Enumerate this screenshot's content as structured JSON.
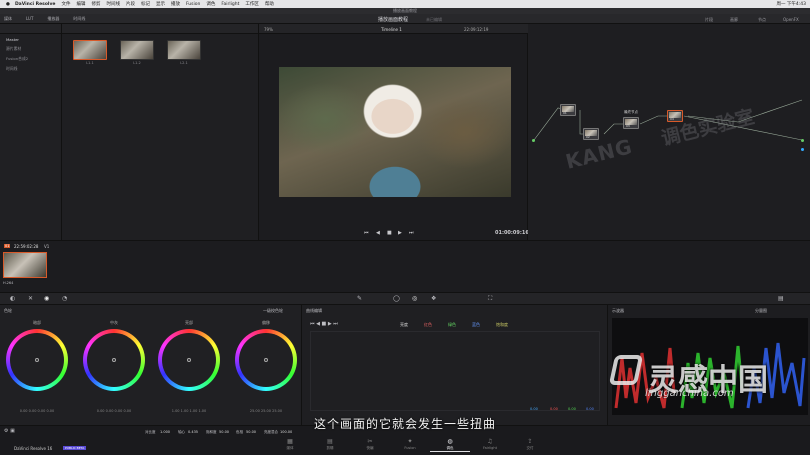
{
  "menubar": {
    "app": "DaVinci Resolve",
    "items": [
      "文件",
      "编辑",
      "修剪",
      "时间线",
      "片段",
      "标记",
      "显示",
      "播放",
      "Fusion",
      "调色",
      "Fairlight",
      "工作区",
      "帮助"
    ],
    "clock": "周一 下午4:43"
  },
  "window_title": "播放画面教程",
  "toolbar": {
    "items": [
      "媒体",
      "LUT",
      "播放器",
      "时间线"
    ],
    "project": "播放画面教程",
    "edited": "未已编辑",
    "right": [
      "片段",
      "画廊",
      "节点",
      "OpenFX"
    ]
  },
  "sidebar": {
    "items": [
      "Master",
      "源片素材",
      "Fusion合成2",
      "时间线"
    ]
  },
  "media": {
    "thumbs": [
      "L1.1",
      "L1.2",
      "L2.1"
    ]
  },
  "viewer": {
    "zoom": "79%",
    "timeline": "Timeline 1",
    "timecode": "22:09:12:19",
    "duration": "01:00:09:16"
  },
  "node_label": "最终节点",
  "clip": {
    "timecode": "22:59:02:28",
    "track": "V1",
    "codec": "H.264"
  },
  "wheels": {
    "title": "色轮",
    "mode": "一级校色轮",
    "labels": [
      "暗部",
      "中灰",
      "亮部",
      "偏移"
    ],
    "values": [
      "0.00  0.00  0.00  0.00",
      "0.00  0.00  0.00  0.00",
      "1.00  1.00  1.00  1.00",
      "25.00  25.00  25.00"
    ]
  },
  "bottom_params": {
    "contrast_label": "对比度",
    "contrast_value": "1.000",
    "pivot_label": "轴心",
    "pivot_value": "0.435",
    "sat_label": "饱和度",
    "sat_value": "50.00",
    "hue_label": "色相",
    "hue_value": "50.00",
    "lum_label": "亮度混合",
    "lum_value": "100.00"
  },
  "curves": {
    "title": "曲线编辑",
    "channels": [
      "亮度",
      "红色",
      "绿色",
      "蓝色",
      "饱和度"
    ],
    "values": [
      "0.00",
      "0.00",
      "0.00",
      "0.00"
    ]
  },
  "scope": {
    "title": "示波器",
    "mode": "分量图"
  },
  "bottom": {
    "app": "DaVinci Resolve 16",
    "badge": "PUBLIC BETA",
    "pages": [
      "媒体",
      "剪辑",
      "快编",
      "Fusion",
      "调色",
      "Fairlight",
      "交付"
    ],
    "active": "调色"
  },
  "subtitle": "这个画面的它就会发生一些扭曲",
  "watermark_kang": "KANG",
  "watermark_lab": "调色实验室",
  "watermark_logo": "灵感中国",
  "watermark_url": "lingganchina.com",
  "colors": {
    "accent": "#d85a2a",
    "bg": "#1b1b1e"
  }
}
